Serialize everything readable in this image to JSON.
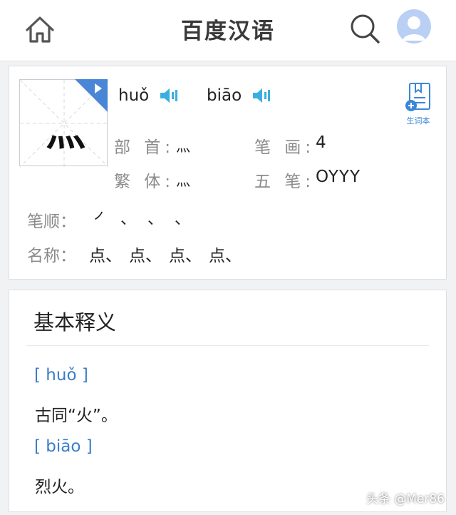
{
  "header": {
    "title": "百度汉语"
  },
  "character": {
    "glyph": "灬",
    "readings": [
      {
        "pinyin": "huǒ"
      },
      {
        "pinyin": "biāo"
      }
    ],
    "radical_label": "部 首:",
    "radical_value": "灬",
    "strokes_label": "笔 画:",
    "strokes_value": "4",
    "traditional_label": "繁 体:",
    "traditional_value": "灬",
    "wubi_label": "五 笔:",
    "wubi_value": "OYYY",
    "stroke_order_label": "笔顺：",
    "stroke_order": [
      "㇒",
      "、",
      "、",
      "、"
    ],
    "stroke_names_label": "名称：",
    "stroke_names": [
      "点、",
      "点、",
      "点、",
      "点、"
    ],
    "vocab_label": "生词本"
  },
  "basic_definition": {
    "title": "基本释义",
    "entries": [
      {
        "pinyin": "[ huǒ ]",
        "meaning": "古同“火”。"
      },
      {
        "pinyin": "[ biāo ]",
        "meaning": "烈火。"
      }
    ]
  },
  "watermark": "头条 @Mer86",
  "colors": {
    "accent": "#3a7dc9",
    "speaker": "#3aaee0",
    "corner": "#4a86d6"
  }
}
